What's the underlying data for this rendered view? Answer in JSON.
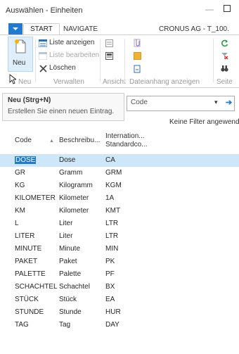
{
  "window": {
    "title": "Auswählen - Einheiten",
    "minimize": "—"
  },
  "ribbon": {
    "tabs": [
      "START",
      "NAVIGATE"
    ],
    "company": "CRONUS AG - T_100.",
    "new_label": "Neu",
    "new_group_label": "Neu",
    "list_view": "Liste anzeigen",
    "list_edit": "Liste bearbeiten",
    "delete": "Löschen",
    "manage_group": "Verwalten",
    "view_group": "Ansicht",
    "attachment_group": "Dateianhang anzeigen",
    "page_group": "Seite"
  },
  "tooltip": {
    "title": "Neu (Strg+N)",
    "text": "Erstellen Sie einen neuen Eintrag."
  },
  "filter": {
    "field": "Code",
    "status": "Keine Filter angewendet"
  },
  "table": {
    "headers": [
      "Code",
      "Beschreibu...",
      "Internation...",
      "Standardco..."
    ],
    "rows": [
      {
        "code": "DOSE",
        "desc": "Dose",
        "intl": "CA"
      },
      {
        "code": "GR",
        "desc": "Gramm",
        "intl": "GRM"
      },
      {
        "code": "KG",
        "desc": "Kilogramm",
        "intl": "KGM"
      },
      {
        "code": "KILOMETER",
        "desc": "Kilometer",
        "intl": "1A"
      },
      {
        "code": "KM",
        "desc": "Kilometer",
        "intl": "KMT"
      },
      {
        "code": "L",
        "desc": "Liter",
        "intl": "LTR"
      },
      {
        "code": "LITER",
        "desc": "Liter",
        "intl": "LTR"
      },
      {
        "code": "MINUTE",
        "desc": "Minute",
        "intl": "MIN"
      },
      {
        "code": "PAKET",
        "desc": "Paket",
        "intl": "PK"
      },
      {
        "code": "PALETTE",
        "desc": "Palette",
        "intl": "PF"
      },
      {
        "code": "SCHACHTEL",
        "desc": "Schachtel",
        "intl": "BX"
      },
      {
        "code": "STÜCK",
        "desc": "Stück",
        "intl": "EA"
      },
      {
        "code": "STUNDE",
        "desc": "Stunde",
        "intl": "HUR"
      },
      {
        "code": "TAG",
        "desc": "Tag",
        "intl": "DAY"
      }
    ]
  },
  "colors": {
    "accent": "#1e7ad3",
    "selected_row": "#cde6f8"
  }
}
